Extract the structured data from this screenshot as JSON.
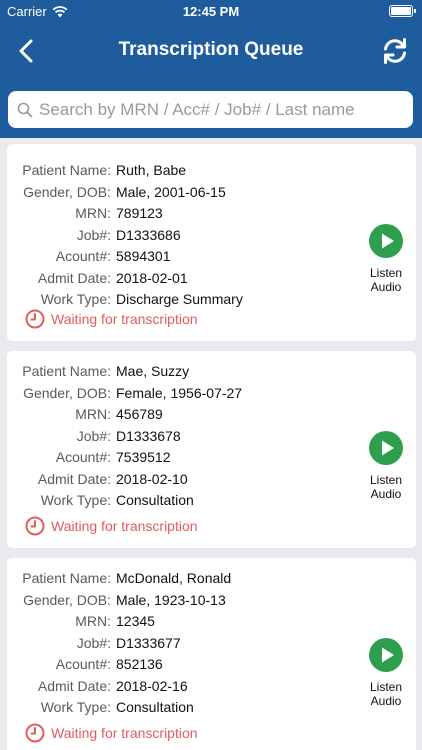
{
  "statusbar": {
    "carrier": "Carrier",
    "time": "12:45 PM"
  },
  "nav": {
    "title": "Transcription Queue"
  },
  "search": {
    "placeholder": "Search by MRN / Acc# / Job# / Last name"
  },
  "labels": {
    "patient_name": "Patient Name:",
    "gender_dob": "Gender, DOB:",
    "mrn": "MRN:",
    "job": "Job#:",
    "account": "Acount#:",
    "admit_date": "Admit Date:",
    "work_type": "Work Type:",
    "listen": "Listen",
    "audio": "Audio"
  },
  "cards": [
    {
      "patient_name": "Ruth, Babe",
      "gender_dob": "Male, 2001-06-15",
      "mrn": "789123",
      "job": "D1333686",
      "account": "5894301",
      "admit_date": "2018-02-01",
      "work_type": "Discharge Summary",
      "status": "Waiting for transcription"
    },
    {
      "patient_name": "Mae, Suzzy",
      "gender_dob": "Female, 1956-07-27",
      "mrn": "456789",
      "job": "D1333678",
      "account": "7539512",
      "admit_date": "2018-02-10",
      "work_type": "Consultation",
      "status": "Waiting for transcription"
    },
    {
      "patient_name": "McDonald, Ronald",
      "gender_dob": "Male, 1923-10-13",
      "mrn": "12345",
      "job": "D1333677",
      "account": "852136",
      "admit_date": "2018-02-16",
      "work_type": "Consultation",
      "status": "Waiting for transcription"
    }
  ],
  "colors": {
    "header": "#1e5c9e",
    "play": "#2e9e4f",
    "status": "#e35c5c"
  },
  "icons": {
    "back": "chevron-left-icon",
    "refresh": "refresh-icon",
    "search": "search-icon",
    "play": "play-icon",
    "clock": "clock-icon"
  }
}
